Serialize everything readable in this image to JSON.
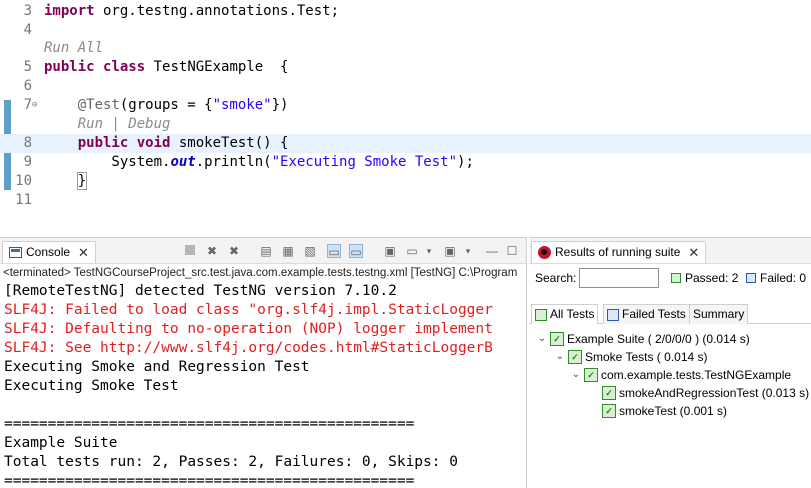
{
  "editor": {
    "lines": [
      {
        "num": "3",
        "segments": [
          {
            "t": "import",
            "c": "kw"
          },
          {
            "t": " org.testng.annotations.Test;",
            "c": ""
          }
        ]
      },
      {
        "num": "4",
        "segments": []
      },
      {
        "num": "",
        "segments": [
          {
            "t": "Run All",
            "c": "lens"
          }
        ]
      },
      {
        "num": "5",
        "segments": [
          {
            "t": "public",
            "c": "kw"
          },
          {
            "t": " ",
            "c": ""
          },
          {
            "t": "class",
            "c": "kw"
          },
          {
            "t": " TestNGExample  {",
            "c": ""
          }
        ]
      },
      {
        "num": "6",
        "segments": []
      },
      {
        "num": "7",
        "fold": "⊖",
        "segments": [
          {
            "t": "    @Test",
            "c": "ann"
          },
          {
            "t": "(groups = {",
            "c": ""
          },
          {
            "t": "\"smoke\"",
            "c": "str"
          },
          {
            "t": "})",
            "c": ""
          }
        ]
      },
      {
        "num": "",
        "segments": [
          {
            "t": "    Run | Debug",
            "c": "lens"
          }
        ]
      },
      {
        "num": "8",
        "current": true,
        "segments": [
          {
            "t": "    ",
            "c": ""
          },
          {
            "t": "public",
            "c": "kw"
          },
          {
            "t": " ",
            "c": ""
          },
          {
            "t": "void",
            "c": "kw"
          },
          {
            "t": " smokeTest() {",
            "c": ""
          }
        ]
      },
      {
        "num": "9",
        "segments": [
          {
            "t": "        System.",
            "c": ""
          },
          {
            "t": "out",
            "c": "fld"
          },
          {
            "t": ".println(",
            "c": ""
          },
          {
            "t": "\"Executing Smoke Test\"",
            "c": "str"
          },
          {
            "t": ");",
            "c": ""
          }
        ]
      },
      {
        "num": "10",
        "segments": [
          {
            "t": "    ",
            "c": ""
          },
          {
            "t": "}",
            "c": "caret"
          }
        ]
      },
      {
        "num": "11",
        "segments": []
      }
    ]
  },
  "console": {
    "tab_label": "Console",
    "close_glyph": "✕",
    "status": "<terminated> TestNGCourseProject_src.test.java.com.example.tests.testng.xml [TestNG] C:\\Program",
    "output": [
      {
        "text": "[RemoteTestNG] detected TestNG version 7.10.2",
        "color": "black"
      },
      {
        "text": "SLF4J: Failed to load class \"org.slf4j.impl.StaticLogger",
        "color": "red"
      },
      {
        "text": "SLF4J: Defaulting to no-operation (NOP) logger implement",
        "color": "red"
      },
      {
        "text": "SLF4J: See http://www.slf4j.org/codes.html#StaticLoggerB",
        "color": "red"
      },
      {
        "text": "Executing Smoke and Regression Test",
        "color": "black"
      },
      {
        "text": "Executing Smoke Test",
        "color": "black"
      },
      {
        "text": "",
        "color": "black"
      },
      {
        "text": "===============================================",
        "color": "black"
      },
      {
        "text": "Example Suite",
        "color": "black"
      },
      {
        "text": "Total tests run: 2, Passes: 2, Failures: 0, Skips: 0",
        "color": "black"
      },
      {
        "text": "===============================================",
        "color": "black"
      }
    ]
  },
  "testng": {
    "tab_label": "Results of running suite",
    "close_glyph": "✕",
    "search_label": "Search:",
    "search_value": "",
    "passed_label": "Passed: 2",
    "failed_label": "Failed: 0",
    "subtabs": [
      "All Tests",
      "Failed Tests",
      "Summary"
    ],
    "tree": [
      {
        "label": "Example Suite ( 2/0/0/0 ) (0.014 s)",
        "level": 0,
        "chevron": "⌄"
      },
      {
        "label": "Smoke Tests ( 0.014 s)",
        "level": 1,
        "chevron": "⌄"
      },
      {
        "label": "com.example.tests.TestNGExample",
        "level": 2,
        "chevron": "⌄"
      },
      {
        "label": "smokeAndRegressionTest  (0.013 s)",
        "level": 3,
        "chevron": ""
      },
      {
        "label": "smokeTest  (0.001 s)",
        "level": 3,
        "chevron": ""
      }
    ]
  },
  "colors": {
    "keyword": "#7f0055",
    "string": "#2a00ff",
    "error_text": "#e02020",
    "current_line": "#e8f2fe",
    "pass_green": "#2e8b2e"
  }
}
